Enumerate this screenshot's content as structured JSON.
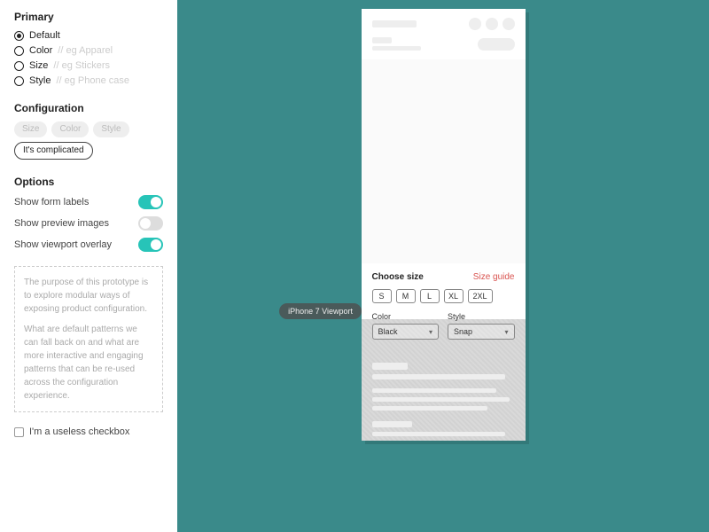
{
  "sidebar": {
    "primary": {
      "title": "Primary",
      "options": [
        {
          "label": "Default",
          "hint": "",
          "checked": true
        },
        {
          "label": "Color",
          "hint": " // eg Apparel",
          "checked": false
        },
        {
          "label": "Size",
          "hint": " // eg Stickers",
          "checked": false
        },
        {
          "label": "Style",
          "hint": " // eg Phone case",
          "checked": false
        }
      ]
    },
    "configuration": {
      "title": "Configuration",
      "chips": [
        "Size",
        "Color",
        "Style"
      ],
      "complicated": "It's complicated"
    },
    "options": {
      "title": "Options",
      "rows": [
        {
          "label": "Show form labels",
          "on": true
        },
        {
          "label": "Show preview images",
          "on": false
        },
        {
          "label": "Show viewport overlay",
          "on": true
        }
      ]
    },
    "note": {
      "p1": "The purpose of this prototype is to explore modular ways of exposing product configuration.",
      "p2": "What are default patterns we can fall back on and what are more interactive and engaging patterns that can be re-used across the configuration experience."
    },
    "checkbox_label": "I'm a useless checkbox"
  },
  "canvas": {
    "tooltip": "iPhone 7 Viewport",
    "config": {
      "choose_label": "Choose size",
      "guide_label": "Size guide",
      "sizes": [
        "S",
        "M",
        "L",
        "XL",
        "2XL"
      ],
      "color_label": "Color",
      "color_value": "Black",
      "style_label": "Style",
      "style_value": "Snap"
    }
  }
}
